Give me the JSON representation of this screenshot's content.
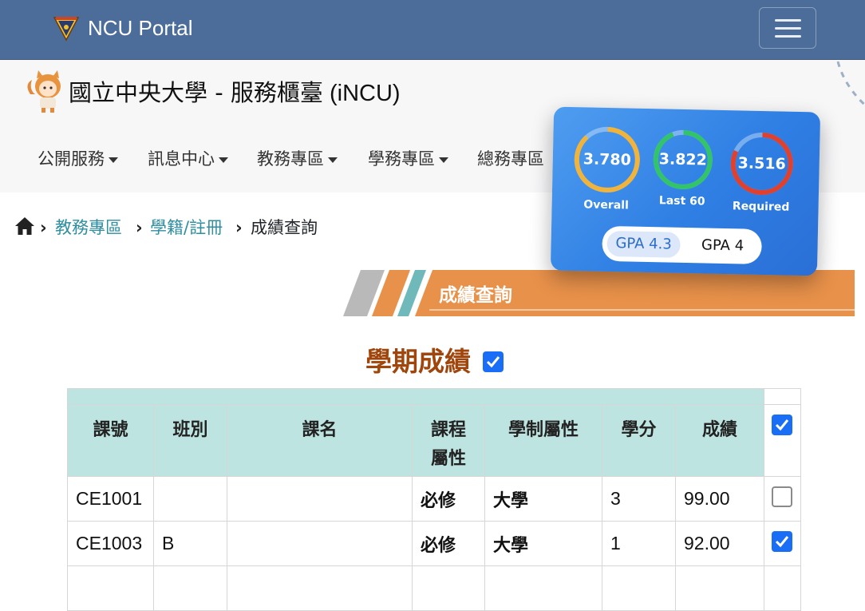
{
  "navbar": {
    "brand": "NCU Portal",
    "logo_icon": "ncu-seal-logo",
    "menu_icon": "hamburger-menu-icon"
  },
  "site": {
    "title_zh": "國立中央大學 - 服務櫃臺",
    "title_suffix": "(iNCU)",
    "mascot_icon": "squirrel-mascot"
  },
  "mainmenu": {
    "items": [
      {
        "label": "公開服務"
      },
      {
        "label": "訊息中心"
      },
      {
        "label": "教務專區"
      },
      {
        "label": "學務專區"
      },
      {
        "label": "總務專區"
      }
    ]
  },
  "breadcrumb": {
    "home_icon": "home-icon",
    "items": [
      "教務專區",
      "學籍/註冊",
      "成績查詢"
    ]
  },
  "section": {
    "title": "成績查詢"
  },
  "semester": {
    "title": "學期成績",
    "checked": true
  },
  "table": {
    "headers": {
      "course_no": "課號",
      "class": "班別",
      "course_name": "課名",
      "type_line1": "課程",
      "type_line2": "屬性",
      "level": "學制屬性",
      "credits": "學分",
      "grade": "成績"
    },
    "header_checked": true,
    "rows": [
      {
        "course_no": "CE1001",
        "class": "",
        "course_name": "",
        "type": "必修",
        "level": "大學",
        "credits": "3",
        "grade": "99.00",
        "checked": false
      },
      {
        "course_no": "CE1003",
        "class": "B",
        "course_name": "",
        "type": "必修",
        "level": "大學",
        "credits": "1",
        "grade": "92.00",
        "checked": true
      }
    ]
  },
  "gpa_card": {
    "rings": [
      {
        "value": "3.780",
        "label": "Overall",
        "color": "#f0b43c"
      },
      {
        "value": "3.822",
        "label": "Last 60",
        "color": "#33c46a"
      },
      {
        "value": "3.516",
        "label": "Required",
        "color": "#e0412e"
      }
    ],
    "scale_options": [
      "GPA 4.3",
      "GPA 4"
    ],
    "selected_scale": "GPA 4.3"
  },
  "colors": {
    "navbar": "#4c6d9a",
    "table_header": "#bde4e0",
    "accent_link": "#2f8ea0",
    "semester_title": "#a0450b",
    "banner_orange": "#e8914a",
    "checkbox_blue": "#1a6ef5"
  }
}
